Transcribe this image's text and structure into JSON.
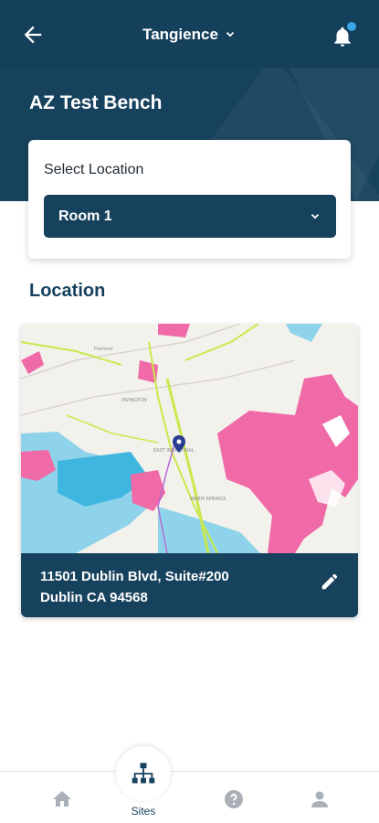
{
  "header": {
    "org_name": "Tangience",
    "site_title": "AZ Test Bench"
  },
  "location_select": {
    "label": "Select Location",
    "selected": "Room 1"
  },
  "location_section": {
    "title": "Location",
    "map_labels": [
      "Fremont",
      "IRVINGTON",
      "EAST INDUSTRIAL",
      "WARM SPRINGS"
    ],
    "address_line1": "11501 Dublin Blvd, Suite#200",
    "address_line2": "Dublin CA 94568"
  },
  "bottom_nav": {
    "active_label": "Sites"
  },
  "colors": {
    "primary": "#17425e",
    "notification_dot": "#3aa5e8",
    "map_water": "#8fd3ea",
    "map_hazard": "#f06aa7",
    "map_road": "#c9e94b"
  }
}
